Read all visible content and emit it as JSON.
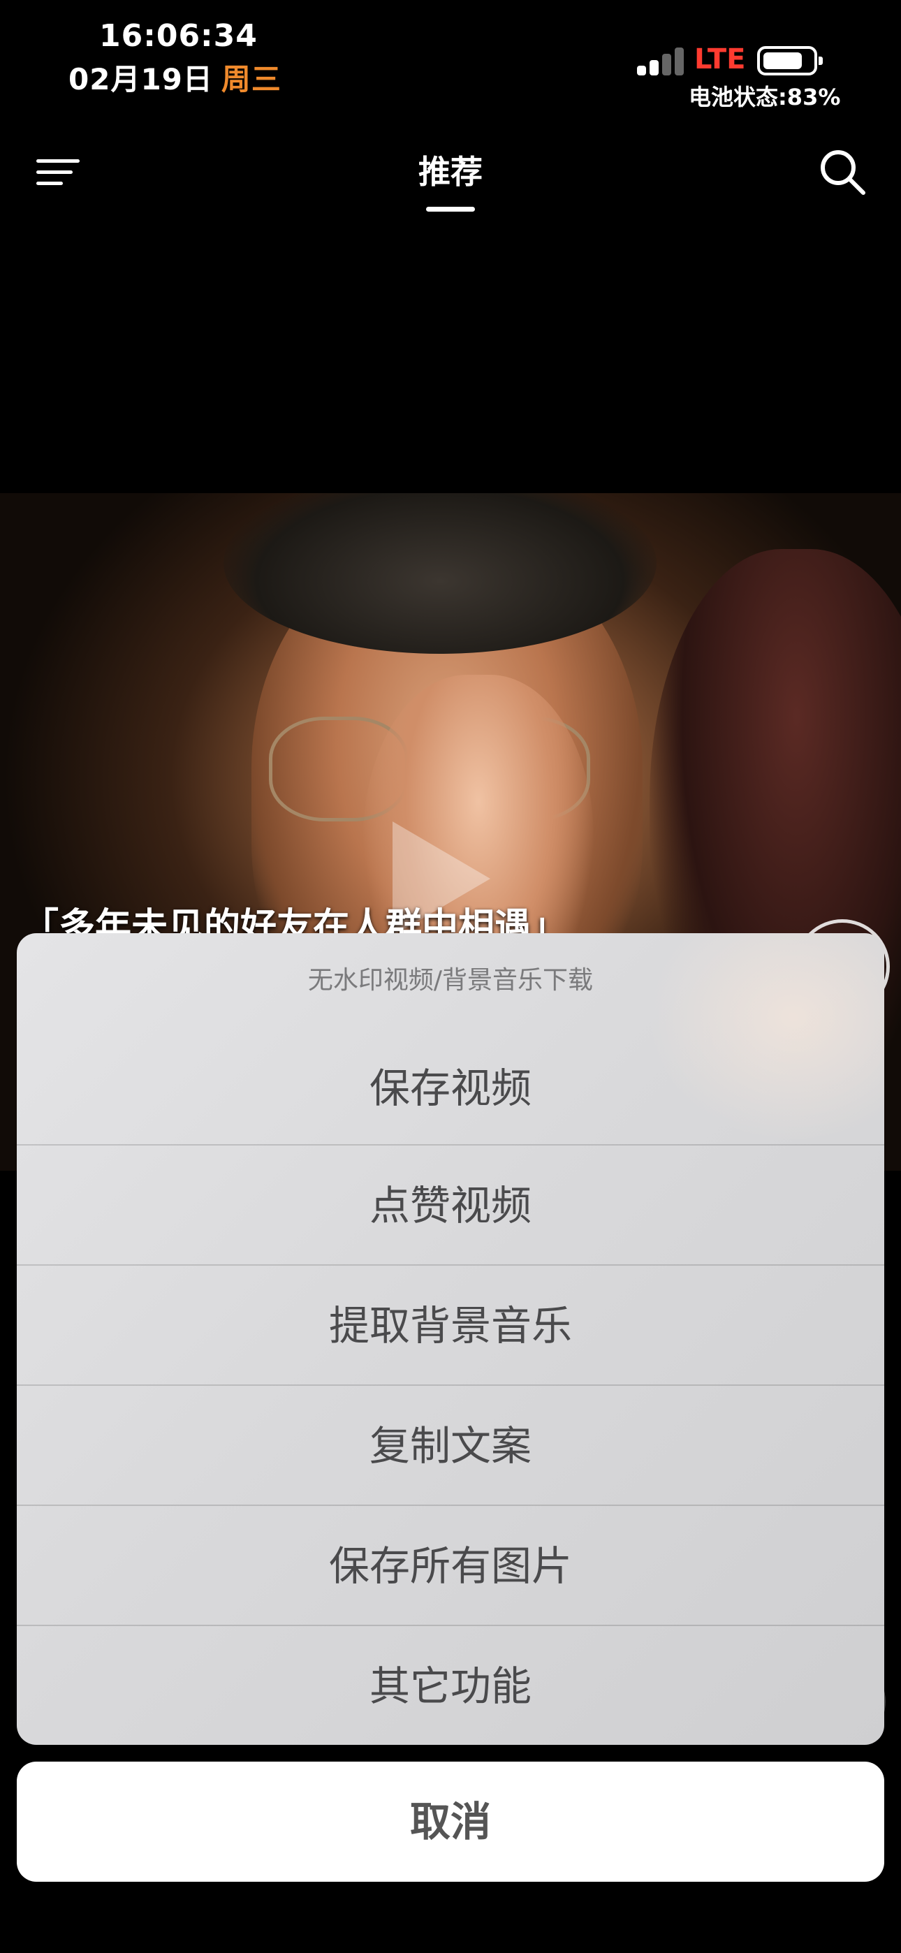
{
  "status_bar": {
    "time": "16:06:34",
    "date": "02月19日",
    "weekday": "周三",
    "network": "LTE",
    "battery_status": "电池状态:83%",
    "battery_level": 0.83,
    "weekday_color": "#f08a2c",
    "network_color": "#ff3b30"
  },
  "nav": {
    "title": "推荐",
    "menu_icon": "menu-icon",
    "search_icon": "search-icon"
  },
  "video": {
    "caption": "「多年未见的好友在人群中相遇」"
  },
  "action_sheet": {
    "title": "无水印视频/背景音乐下载",
    "options": [
      {
        "label": "保存视频"
      },
      {
        "label": "点赞视频"
      },
      {
        "label": "提取背景音乐"
      },
      {
        "label": "复制文案"
      },
      {
        "label": "保存所有图片"
      },
      {
        "label": "其它功能"
      }
    ],
    "cancel_label": "取消"
  }
}
